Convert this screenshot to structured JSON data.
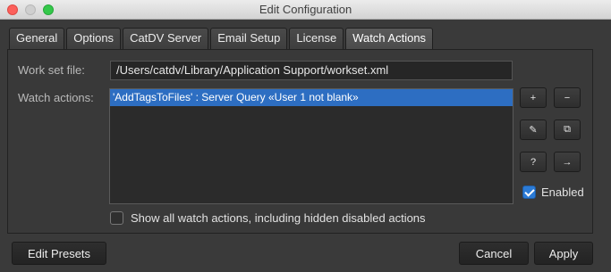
{
  "window": {
    "title": "Edit Configuration"
  },
  "tabs": [
    {
      "label": "General",
      "active": false
    },
    {
      "label": "Options",
      "active": false
    },
    {
      "label": "CatDV Server",
      "active": false
    },
    {
      "label": "Email Setup",
      "active": false
    },
    {
      "label": "License",
      "active": false
    },
    {
      "label": "Watch Actions",
      "active": true
    }
  ],
  "watch": {
    "work_set_label": "Work set file:",
    "work_set_value": "/Users/catdv/Library/Application Support/workset.xml",
    "watch_actions_label": "Watch actions:",
    "items": [
      {
        "label": "'AddTagsToFiles' : Server Query «User 1 not blank»",
        "selected": true
      }
    ],
    "side_buttons": {
      "add": "+",
      "remove": "−",
      "edit": "✎",
      "duplicate": "⧉",
      "help": "?",
      "run": "→"
    },
    "enabled_label": "Enabled",
    "enabled_checked": true,
    "show_all_label": "Show all watch actions, including hidden disabled actions",
    "show_all_checked": false
  },
  "footer": {
    "edit_presets": "Edit Presets",
    "cancel": "Cancel",
    "apply": "Apply"
  },
  "colors": {
    "selection": "#2d6ec2",
    "checkbox_on": "#2b7bd6",
    "close": "#fc605b",
    "maximize": "#34c84a"
  }
}
